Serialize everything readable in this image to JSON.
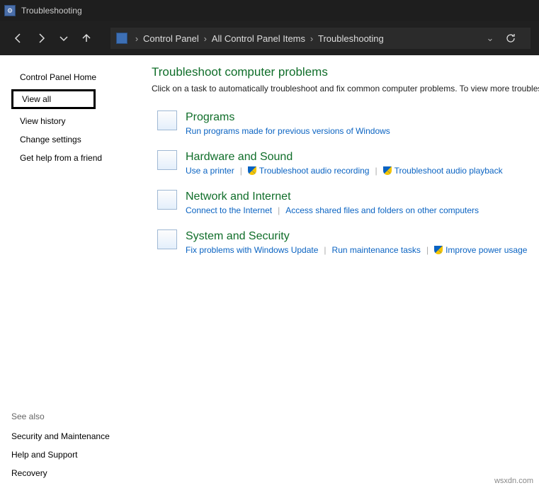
{
  "window": {
    "title": "Troubleshooting"
  },
  "breadcrumb": {
    "items": [
      "Control Panel",
      "All Control Panel Items",
      "Troubleshooting"
    ]
  },
  "sidebar": {
    "items": [
      "Control Panel Home",
      "View all",
      "View history",
      "Change settings",
      "Get help from a friend"
    ]
  },
  "seealso": {
    "header": "See also",
    "items": [
      "Security and Maintenance",
      "Help and Support",
      "Recovery"
    ]
  },
  "main": {
    "heading": "Troubleshoot computer problems",
    "subtitle": "Click on a task to automatically troubleshoot and fix common computer problems. To view more troubleshooters…",
    "categories": [
      {
        "title": "Programs",
        "links": [
          {
            "label": "Run programs made for previous versions of Windows",
            "shield": false
          }
        ]
      },
      {
        "title": "Hardware and Sound",
        "links": [
          {
            "label": "Use a printer",
            "shield": false
          },
          {
            "label": "Troubleshoot audio recording",
            "shield": true
          },
          {
            "label": "Troubleshoot audio playback",
            "shield": true
          }
        ]
      },
      {
        "title": "Network and Internet",
        "links": [
          {
            "label": "Connect to the Internet",
            "shield": false
          },
          {
            "label": "Access shared files and folders on other computers",
            "shield": false
          }
        ]
      },
      {
        "title": "System and Security",
        "links": [
          {
            "label": "Fix problems with Windows Update",
            "shield": false
          },
          {
            "label": "Run maintenance tasks",
            "shield": false
          },
          {
            "label": "Improve power usage",
            "shield": true
          }
        ]
      }
    ]
  },
  "watermark": "wsxdn.com"
}
